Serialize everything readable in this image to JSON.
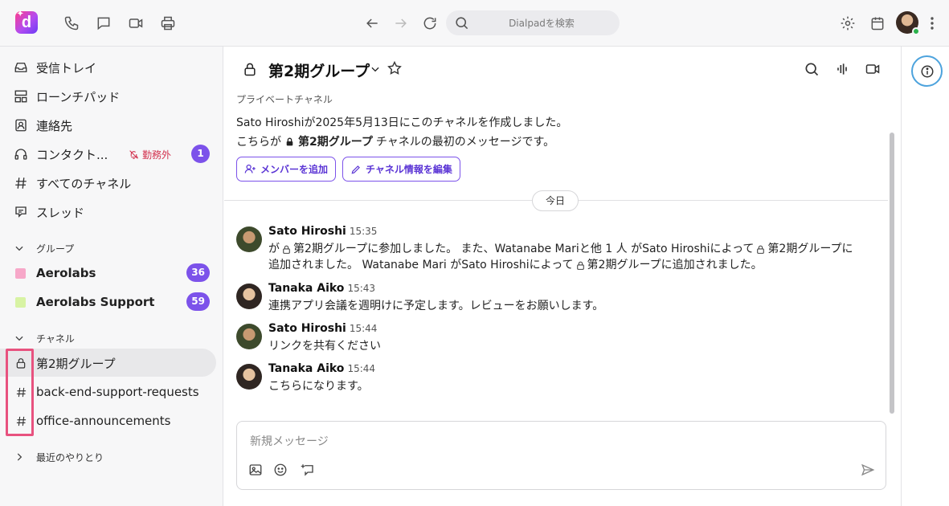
{
  "app": {
    "logo_letter": "d",
    "logo_spark": "✦",
    "search_placeholder": "Dialpadを検索"
  },
  "sidebar": {
    "nav": [
      {
        "label": "受信トレイ",
        "icon": "inbox-icon"
      },
      {
        "label": "ローンチパッド",
        "icon": "launchpad-icon"
      },
      {
        "label": "連絡先",
        "icon": "contacts-icon"
      },
      {
        "label": "コンタクト...",
        "icon": "headset-icon",
        "status": "勤務外",
        "badge": "1"
      },
      {
        "label": "すべてのチャネル",
        "icon": "hash-icon"
      },
      {
        "label": "スレッド",
        "icon": "threads-icon"
      }
    ],
    "groups_header": "グループ",
    "groups": [
      {
        "label": "Aerolabs",
        "badge": "36",
        "color": "#f7a8c9"
      },
      {
        "label": "Aerolabs Support",
        "badge": "59",
        "color": "#d8f3a4"
      }
    ],
    "channels_header": "チャネル",
    "channels": [
      {
        "label": "第2期グループ",
        "icon": "lock-icon",
        "selected": true
      },
      {
        "label": "back-end-support-requests",
        "icon": "hash-icon"
      },
      {
        "label": "office-announcements",
        "icon": "hash-icon"
      }
    ],
    "recent_header": "最近のやりとり"
  },
  "channel": {
    "title": "第2期グループ",
    "private_label": "プライベートチャネル",
    "intro_created": "Sato Hiroshiが2025年5月13日にこのチャネルを作成しました。",
    "intro_prefix": "こちらが",
    "intro_name": "第2期グループ",
    "intro_suffix": "チャネルの最初のメッセージです。",
    "add_member_label": "メンバーを追加",
    "edit_info_label": "チャネル情報を編集",
    "day_divider": "今日"
  },
  "messages": [
    {
      "author": "Sato Hiroshi",
      "time": "15:35",
      "sys_1a": "が",
      "sys_1b": "第2期グループに参加しました。 また、Watanabe Mariと他 1 人 がSato Hiroshiによって",
      "sys_1c": "第2期グループに",
      "sys_2a": "追加されました。 Watanabe Mari がSato Hiroshiによって",
      "sys_2b": "第2期グループに追加されました。"
    },
    {
      "author": "Tanaka Aiko",
      "time": "15:43",
      "text": "連携アプリ会議を週明けに予定します。レビューをお願いします。"
    },
    {
      "author": "Sato Hiroshi",
      "time": "15:44",
      "text": "リンクを共有ください"
    },
    {
      "author": "Tanaka Aiko",
      "time": "15:44",
      "text": "こちらになります。"
    }
  ],
  "composer": {
    "placeholder": "新規メッセージ"
  },
  "colors": {
    "accent": "#7c52ea",
    "offduty": "#d2314e",
    "highlight": "#e8527f",
    "info_ring": "#4da3dd"
  }
}
